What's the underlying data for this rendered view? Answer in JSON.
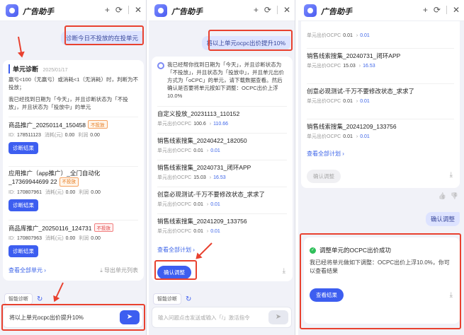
{
  "app": {
    "title": "广告助手"
  },
  "panel1": {
    "user_msg": "诊断今日不投放的在投单元",
    "section_title": "单元诊断",
    "date": "2025/01/17",
    "intro": "赢亏<100（无赢亏）或消耗<1（无消耗）时，判断为不投放；",
    "found": "我已经找到日期为「今天」，并且诊断状态为「不投放」，并且状态为「投放中」的单元",
    "items": [
      {
        "name": "商品推广_20250114_150458",
        "tag": "不投放",
        "id_label": "ID:",
        "id": "178511123",
        "cost_label": "消耗(元)",
        "cost": "0.00",
        "bid_label": "利润",
        "bid": "0.00",
        "btn": "诊断结果"
      },
      {
        "name": "应用推广（app推广）_全门自动化_17369944699 22",
        "tag": "不投放",
        "id_label": "ID:",
        "id": "170807961",
        "cost_label": "消耗(元)",
        "cost": "0.00",
        "bid_label": "利润",
        "bid": "0.00",
        "btn": "诊断结果"
      },
      {
        "name": "商品库推广_20250116_124731",
        "tag": "不投放",
        "id_label": "ID:",
        "id": "170807963",
        "cost_label": "消耗(元)",
        "cost": "0.00",
        "bid_label": "利润",
        "bid": "0.00",
        "btn": "诊断结果"
      }
    ],
    "view_all": "查看全部单元",
    "export": "导出单元列表",
    "quick": "智能诊断",
    "input_value": "将以上单元ocpc出价提升10%"
  },
  "panel2": {
    "user_msg": "将以上单元ocpc出价提升10%",
    "bot_text": "我已经帮你找到日期为「今天」，并且诊断状态为「不投放」，并且状态为「投放中」，并且单元出价方式为「oCPC」的单元，请下载数据查看。然后确认是否要将单元按如下调整：OCPC出价上浮10.0%",
    "items": [
      {
        "name": "自定义投放_20231113_110152",
        "label": "单元出价OCPC",
        "old": "100.6",
        "new": "110.66"
      },
      {
        "name": "销售线索搜集_20240422_182050",
        "label": "单元出价OCPC",
        "old": "0.01",
        "new": "0.01"
      },
      {
        "name": "销售线索搜集_20240731_闭环APP",
        "label": "单元出价OCPC",
        "old": "15.03",
        "new": "16.53"
      },
      {
        "name": "创意必现测试-千万不要修改状态_求求了",
        "label": "单元出价OCPC",
        "old": "0.01",
        "new": "0.01"
      },
      {
        "name": "销售线索搜集_20241209_133756",
        "label": "单元出价OCPC",
        "old": "0.01",
        "new": "0.01"
      }
    ],
    "view_all": "查看全部计划",
    "confirm": "确认调整",
    "quick": "智能诊断",
    "input_placeholder": "输入问题点击发送或输入「/」激活指令"
  },
  "panel3": {
    "top_item": {
      "label": "单元出价OCPC",
      "old": "0.01",
      "new": "0.01"
    },
    "items": [
      {
        "name": "销售线索搜集_20240731_闭环APP",
        "label": "单元出价OCPC",
        "old": "15.03",
        "new": "16.53"
      },
      {
        "name": "创意必现测试-千万不要修改状态_求求了",
        "label": "单元出价OCPC",
        "old": "0.01",
        "new": "0.01"
      },
      {
        "name": "销售线索搜集_20241209_133756",
        "label": "单元出价OCPC",
        "old": "0.01",
        "new": "0.01"
      }
    ],
    "view_all": "查看全部计划",
    "confirm_disabled": "确认调整",
    "user_msg": "确认调整",
    "success_title": "调整单元的OCPC出价成功",
    "success_text": "我已经将单元做如下调整：OCPC出价上浮10.0%，你可以查看结果",
    "view_result": "查看结果"
  },
  "icons": {
    "plus": "+",
    "history": "⟳",
    "close": "✕",
    "chevron": "›",
    "download": "⤓",
    "send": "➤",
    "thumb_up": "👍",
    "thumb_down": "👎",
    "refresh": "↻"
  }
}
